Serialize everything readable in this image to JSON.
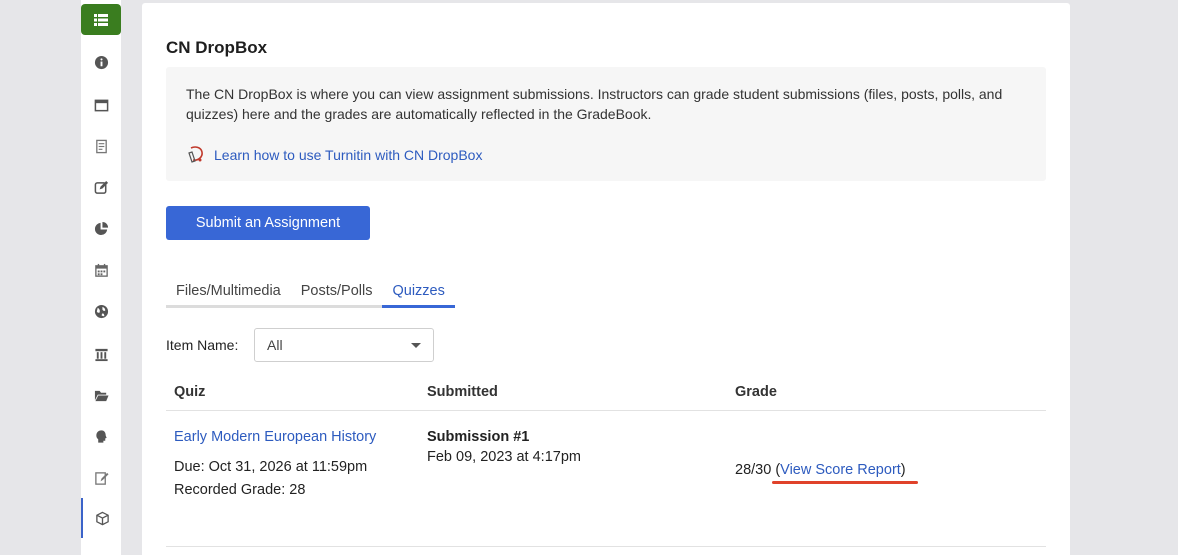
{
  "page": {
    "title": "CN DropBox",
    "info_text": "The CN DropBox is where you can view assignment submissions. Instructors can grade student submissions (files, posts, polls, and quizzes) here and the grades are automatically reflected in the GradeBook.",
    "turnitin_link": "Learn how to use Turnitin with CN DropBox",
    "submit_label": "Submit an Assignment"
  },
  "tabs": [
    {
      "label": "Files/Multimedia"
    },
    {
      "label": "Posts/Polls"
    },
    {
      "label": "Quizzes"
    }
  ],
  "filter": {
    "label": "Item Name:",
    "value": "All"
  },
  "table": {
    "headers": [
      "Quiz",
      "Submitted",
      "Grade"
    ],
    "row": {
      "quiz_name": "Early Modern European History",
      "due": "Due: Oct 31, 2026 at 11:59pm",
      "recorded_grade": "Recorded Grade: 28",
      "submission_title": "Submission #1",
      "submission_date": "Feb 09, 2023 at 4:17pm",
      "grade_value": "28/30",
      "grade_open": "(",
      "view_report": "View Score Report",
      "grade_close": ")"
    }
  },
  "colors": {
    "accent": "#3867d6",
    "link": "#2d5bbf",
    "sidebar_top": "#3a7d1f",
    "highlight": "#e0422a"
  },
  "sidebar_icons": [
    "list-icon",
    "info-icon",
    "window-icon",
    "document-icon",
    "edit-icon",
    "pie-chart-icon",
    "calendar-icon",
    "globe-icon",
    "building-icon",
    "folder-icon",
    "head-icon",
    "note-icon",
    "cube-icon"
  ]
}
